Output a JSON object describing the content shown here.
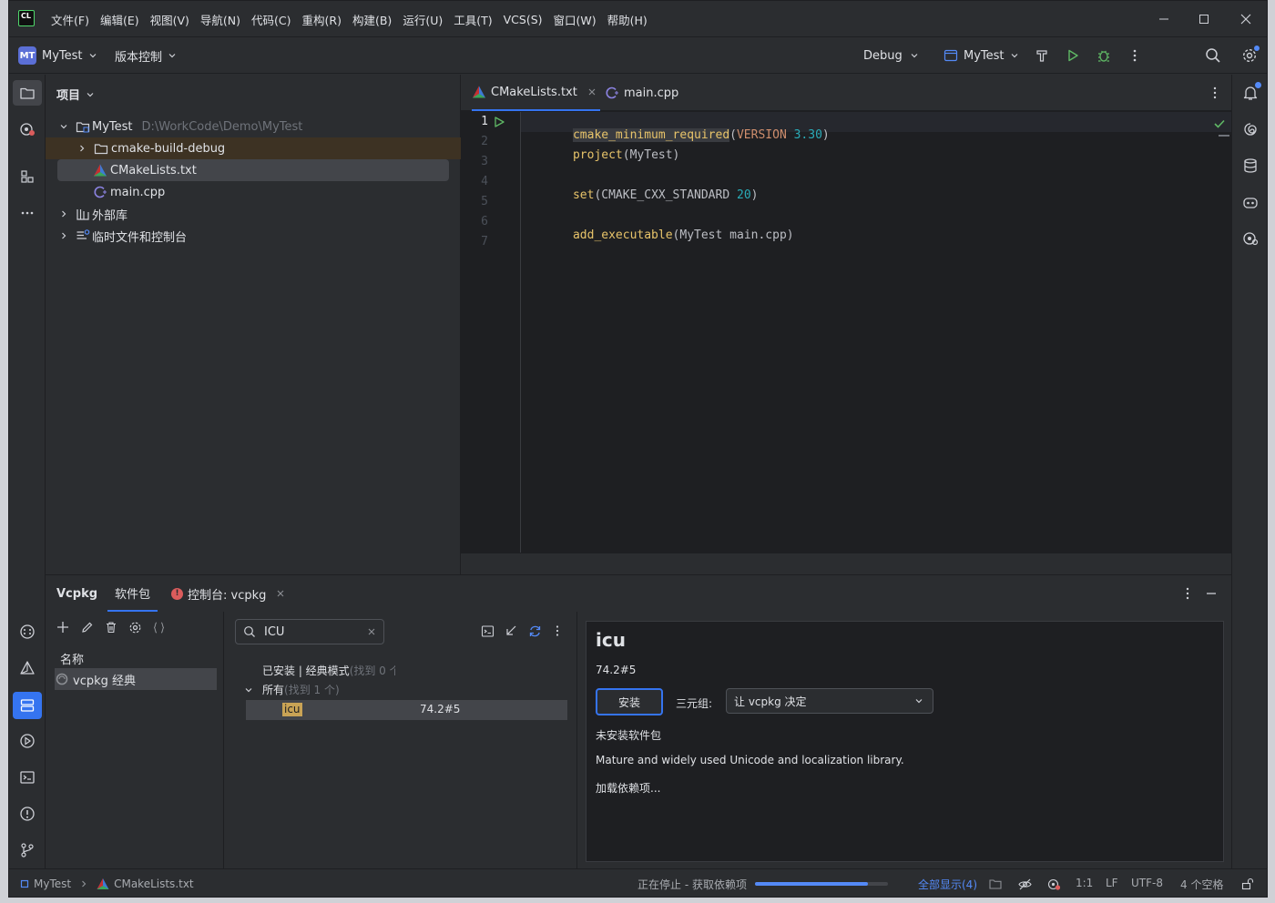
{
  "window": {
    "app_icon_text": "CL",
    "menus": [
      "文件(F)",
      "编辑(E)",
      "视图(V)",
      "导航(N)",
      "代码(C)",
      "重构(R)",
      "构建(B)",
      "运行(U)",
      "工具(T)",
      "VCS(S)",
      "窗口(W)",
      "帮助(H)"
    ]
  },
  "toolbar": {
    "project_badge": "MT",
    "project_name": "MyTest",
    "vcs_label": "版本控制",
    "config_label": "Debug",
    "run_target": "MyTest"
  },
  "project_panel": {
    "title": "项目",
    "root": {
      "name": "MyTest",
      "path": "D:\\WorkCode\\Demo\\MyTest"
    },
    "items": [
      {
        "name": "cmake-build-debug"
      },
      {
        "name": "CMakeLists.txt"
      },
      {
        "name": "main.cpp"
      },
      {
        "name": "外部库"
      },
      {
        "name": "临时文件和控制台"
      }
    ]
  },
  "editor": {
    "tabs": [
      {
        "label": "CMakeLists.txt",
        "active": true
      },
      {
        "label": "main.cpp",
        "active": false
      }
    ],
    "line_numbers": [
      "1",
      "2",
      "3",
      "4",
      "5",
      "6",
      "7"
    ],
    "code": {
      "l1_fn": "cmake_minimum_required",
      "l1_p1": "(",
      "l1_kw": "VERSION",
      "l1_num": "3.30",
      "l1_p2": ")",
      "l2_fn": "project",
      "l2_rest": "(MyTest)",
      "l4_fn": "set",
      "l4_mid": "(CMAKE_CXX_STANDARD ",
      "l4_num": "20",
      "l4_end": ")",
      "l6_fn": "add_executable",
      "l6_rest": "(MyTest main.cpp)"
    }
  },
  "bottom_panel": {
    "tabs": {
      "vcpkg": "Vcpkg",
      "packages": "软件包",
      "console": "控制台: vcpkg"
    },
    "registry": {
      "header": "名称",
      "item": "vcpkg 经典"
    },
    "search": {
      "value": "ICU"
    },
    "results": {
      "installed_label": "已安装 | 经典模式",
      "installed_count": "(找到 0 个)",
      "all_label": "所有",
      "all_count": "(找到 1 个)",
      "package_name": "icu",
      "package_version": "74.2#5"
    },
    "details": {
      "name": "icu",
      "version": "74.2#5",
      "install_button": "安装",
      "triplet_label": "三元组:",
      "triplet_value": "让 vcpkg 决定",
      "status": "未安装软件包",
      "description": "Mature and widely used Unicode and localization library.",
      "deps": "加载依赖项..."
    }
  },
  "status_bar": {
    "crumb_project": "MyTest",
    "crumb_file": "CMakeLists.txt",
    "progress_text": "正在停止 - 获取依赖项",
    "progress": 0.85,
    "show_all": "全部显示(4)",
    "position": "1:1",
    "line_ending": "LF",
    "encoding": "UTF-8",
    "indent": "4 个空格"
  },
  "colors": {
    "accent": "#3574f0",
    "keyword": "#cf8e6d",
    "function": "#e8c46a",
    "number": "#2aacb8",
    "run_green": "#5fb865",
    "error_red": "#db5c5c"
  }
}
